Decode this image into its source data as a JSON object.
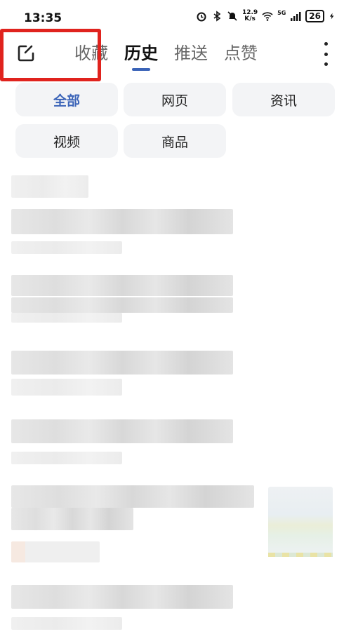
{
  "status_bar": {
    "time": "13:35",
    "net_speed_value": "12.9",
    "net_speed_unit": "K/s",
    "signal_label": "5G",
    "battery": "26"
  },
  "topnav": {
    "edit_icon": "edit-icon",
    "tabs": [
      {
        "label": "收藏",
        "active": false
      },
      {
        "label": "历史",
        "active": true
      },
      {
        "label": "推送",
        "active": false
      },
      {
        "label": "点赞",
        "active": false
      }
    ],
    "more_icon": "more-vertical-icon"
  },
  "filters": [
    {
      "label": "全部",
      "active": true
    },
    {
      "label": "网页",
      "active": false
    },
    {
      "label": "资讯",
      "active": false
    },
    {
      "label": "视频",
      "active": false
    },
    {
      "label": "商品",
      "active": false
    }
  ],
  "colors": {
    "accent": "#3b64b8",
    "highlight": "#e0231e",
    "chip_bg": "#f3f4f6"
  }
}
